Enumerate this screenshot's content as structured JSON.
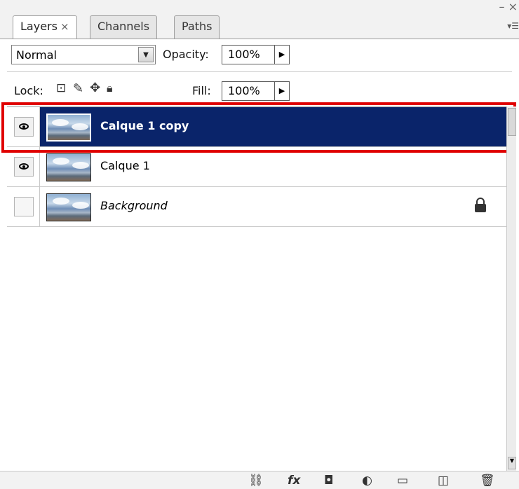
{
  "tabs": [
    {
      "label": "Layers",
      "close": "×"
    },
    {
      "label": "Channels"
    },
    {
      "label": "Paths"
    }
  ],
  "controls": {
    "blend_mode": "Normal",
    "opacity_label": "Opacity:",
    "opacity_value": "100%",
    "lock_label": "Lock:",
    "fill_label": "Fill:",
    "fill_value": "100%"
  },
  "layers": [
    {
      "name": "Calque 1 copy",
      "visible": true,
      "selected": true,
      "locked": false
    },
    {
      "name": "Calque 1",
      "visible": true,
      "selected": false,
      "locked": false
    },
    {
      "name": "Background",
      "visible": false,
      "selected": false,
      "locked": true
    }
  ],
  "colors": {
    "selection": "#0a246a",
    "highlight_outline": "#e00000"
  },
  "icons": {
    "lock_transparent": "checker-icon",
    "lock_image": "brush-icon",
    "lock_position": "move-icon",
    "lock_all": "lock-icon",
    "footer": [
      "link-icon",
      "fx-icon",
      "mask-icon",
      "adjustment-icon",
      "folder-icon",
      "new-layer-icon",
      "trash-icon"
    ]
  },
  "footer_labels": {
    "fx": "fx"
  }
}
